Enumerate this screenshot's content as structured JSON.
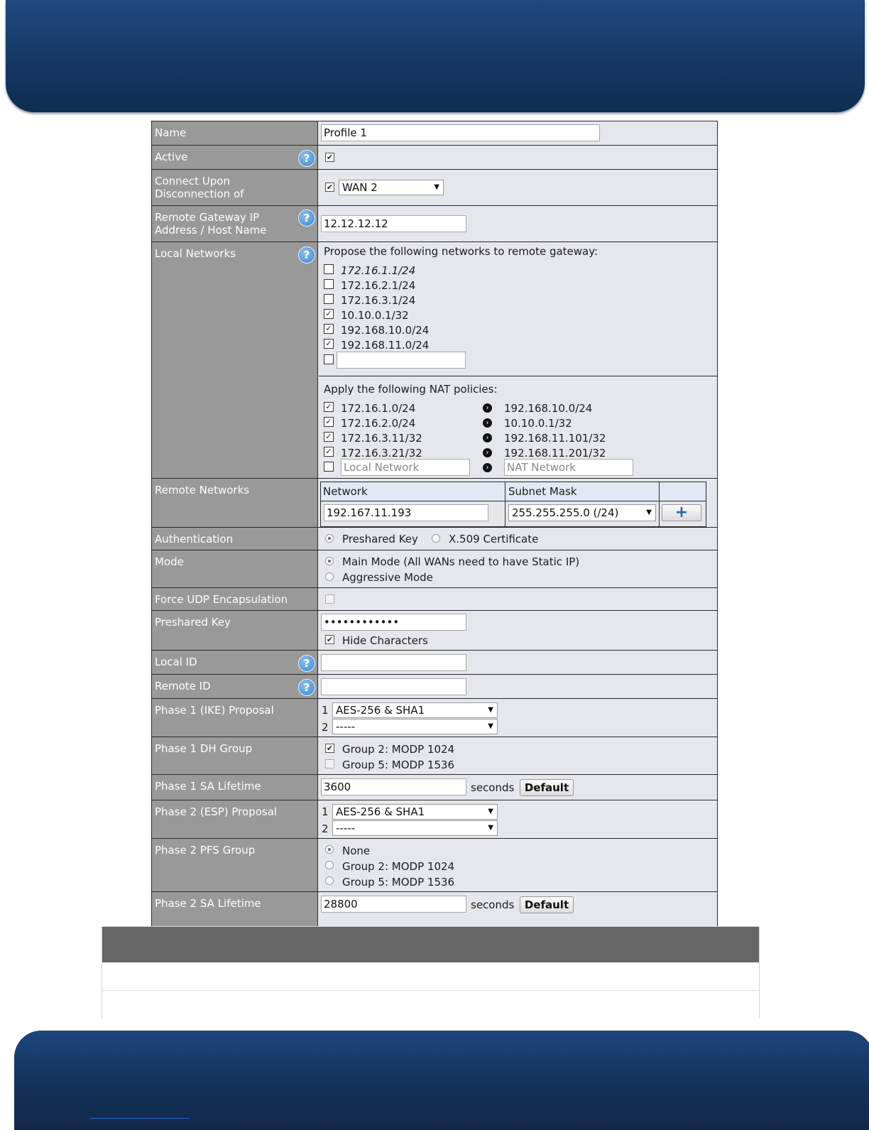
{
  "form": {
    "name": {
      "label": "Name",
      "value": "Profile 1"
    },
    "active": {
      "label": "Active",
      "checked": true
    },
    "connect_upon": {
      "label": "Connect Upon Disconnection of",
      "checked": true,
      "wan": "WAN 2"
    },
    "remote_gateway": {
      "label": "Remote Gateway IP Address / Host Name",
      "value": "12.12.12.12"
    },
    "local_networks": {
      "label": "Local Networks",
      "propose_text": "Propose the following networks to remote gateway:",
      "networks": [
        {
          "value": "172.16.1.1/24",
          "checked": false
        },
        {
          "value": "172.16.2.1/24",
          "checked": false
        },
        {
          "value": "172.16.3.1/24",
          "checked": false
        },
        {
          "value": "10.10.0.1/32",
          "checked": true
        },
        {
          "value": "192.168.10.0/24",
          "checked": true
        },
        {
          "value": "192.168.11.0/24",
          "checked": true
        }
      ],
      "nat_text": "Apply the following NAT policies:",
      "nat_policies": [
        {
          "local": "172.16.1.0/24",
          "nat": "192.168.10.0/24",
          "checked": true
        },
        {
          "local": "172.16.2.0/24",
          "nat": "10.10.0.1/32",
          "checked": true
        },
        {
          "local": "172.16.3.11/32",
          "nat": "192.168.11.101/32",
          "checked": true
        },
        {
          "local": "172.16.3.21/32",
          "nat": "192.168.11.201/32",
          "checked": true
        }
      ],
      "local_network_placeholder": "Local Network",
      "nat_network_placeholder": "NAT Network"
    },
    "remote_networks": {
      "label": "Remote Networks",
      "col_network": "Network",
      "col_subnet": "Subnet Mask",
      "network_value": "192.167.11.193",
      "subnet_value": "255.255.255.0 (/24)",
      "add_symbol": "+"
    },
    "authentication": {
      "label": "Authentication",
      "options": [
        "Preshared Key",
        "X.509 Certificate"
      ],
      "selected": "Preshared Key"
    },
    "mode": {
      "label": "Mode",
      "options": [
        "Main Mode (All WANs need to have Static IP)",
        "Aggressive Mode"
      ],
      "selected": "Main Mode (All WANs need to have Static IP)"
    },
    "force_udp": {
      "label": "Force UDP Encapsulation",
      "checked": false
    },
    "preshared_key": {
      "label": "Preshared Key",
      "value": "••••••••••••",
      "hide_label": "Hide Characters",
      "hide_checked": true
    },
    "local_id": {
      "label": "Local ID",
      "value": ""
    },
    "remote_id": {
      "label": "Remote ID",
      "value": ""
    },
    "phase1_proposal": {
      "label": "Phase 1 (IKE) Proposal",
      "items": [
        {
          "num": "1",
          "value": "AES-256 & SHA1"
        },
        {
          "num": "2",
          "value": "-----"
        }
      ]
    },
    "phase1_dh": {
      "label": "Phase 1 DH Group",
      "options": [
        {
          "label": "Group 2: MODP 1024",
          "checked": true
        },
        {
          "label": "Group 5: MODP 1536",
          "checked": false
        }
      ]
    },
    "phase1_lifetime": {
      "label": "Phase 1 SA Lifetime",
      "value": "3600",
      "unit": "seconds",
      "default_btn": "Default"
    },
    "phase2_proposal": {
      "label": "Phase 2 (ESP) Proposal",
      "items": [
        {
          "num": "1",
          "value": "AES-256 & SHA1"
        },
        {
          "num": "2",
          "value": "-----"
        }
      ]
    },
    "phase2_pfs": {
      "label": "Phase 2 PFS Group",
      "options": [
        "None",
        "Group 2: MODP 1024",
        "Group 5: MODP 1536"
      ],
      "selected": "None"
    },
    "phase2_lifetime": {
      "label": "Phase 2 SA Lifetime",
      "value": "28800",
      "unit": "seconds",
      "default_btn": "Default"
    }
  },
  "icons": {
    "help": "help-icon",
    "arrow": "arrow-right-icon",
    "plus": "plus-icon"
  },
  "colors": {
    "header": "#153864",
    "label_bg": "#999999",
    "value_bg": "#e6e7ec",
    "table_head": "#666666"
  }
}
